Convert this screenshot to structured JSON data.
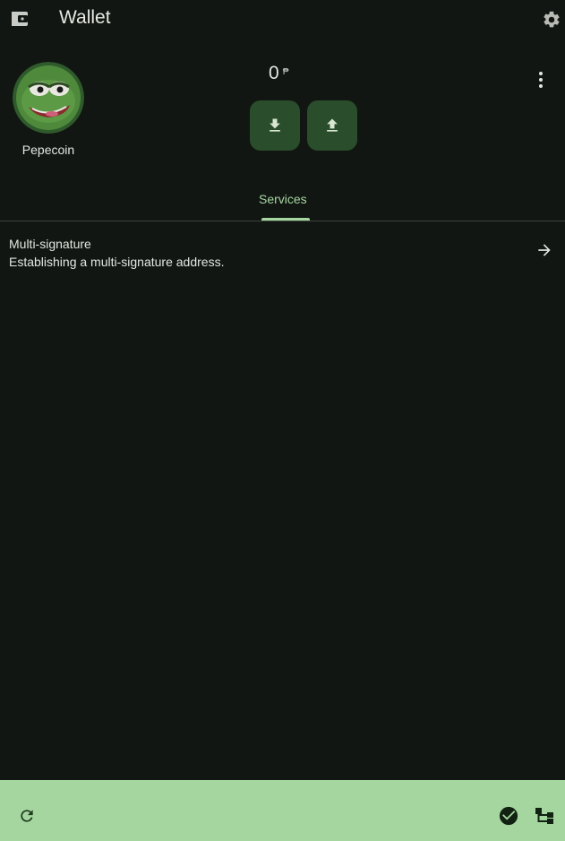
{
  "header": {
    "title": "Wallet",
    "icons": {
      "wallet": "wallet-icon",
      "settings": "gear-icon"
    }
  },
  "coin": {
    "name": "Pepecoin",
    "balance": "0",
    "unit": "₱",
    "avatar": "pepe-frog-logo"
  },
  "actions": {
    "receive": "download-icon",
    "send": "upload-icon",
    "more": "more-vert-icon"
  },
  "tabs": [
    {
      "label": "Services",
      "active": true
    }
  ],
  "services": [
    {
      "title": "Multi-signature",
      "description": "Establishing a multi-signature address.",
      "icon": "arrow-right-icon"
    }
  ],
  "footer": {
    "icons": [
      "refresh-icon",
      "check-circle-icon",
      "network-tree-icon"
    ]
  },
  "colors": {
    "background": "#121612",
    "accent": "#a5d6a0",
    "button": "#2a4d2c"
  }
}
